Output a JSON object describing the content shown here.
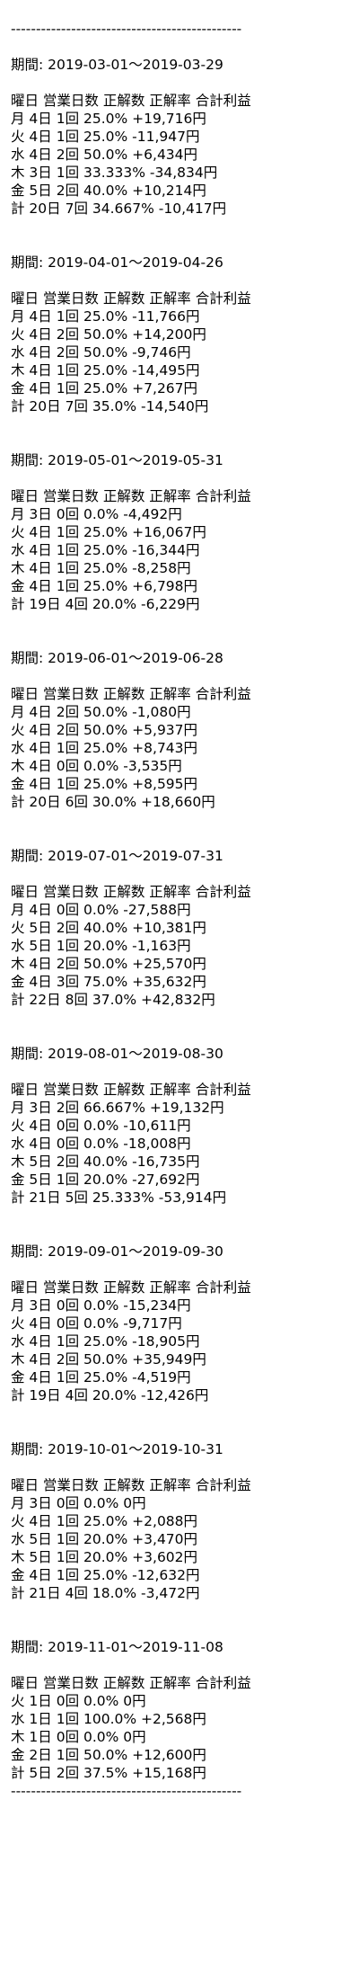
{
  "top_rule": "----------------------------------------------",
  "bottom_rule": "----------------------------------------------",
  "header": "曜日 営業日数 正解数 正解率 合計利益",
  "sections": [
    {
      "period": "期間: 2019-03-01〜2019-03-29",
      "rows": [
        "月 4日 1回 25.0% +19,716円",
        "火 4日 1回 25.0% -11,947円",
        "水 4日 2回 50.0% +6,434円",
        "木 3日 1回 33.333% -34,834円",
        "金 5日 2回 40.0% +10,214円",
        "計 20日 7回 34.667% -10,417円"
      ]
    },
    {
      "period": "期間: 2019-04-01〜2019-04-26",
      "rows": [
        "月 4日 1回 25.0% -11,766円",
        "火 4日 2回 50.0% +14,200円",
        "水 4日 2回 50.0% -9,746円",
        "木 4日 1回 25.0% -14,495円",
        "金 4日 1回 25.0% +7,267円",
        "計 20日 7回 35.0% -14,540円"
      ]
    },
    {
      "period": "期間: 2019-05-01〜2019-05-31",
      "rows": [
        "月 3日 0回 0.0% -4,492円",
        "火 4日 1回 25.0% +16,067円",
        "水 4日 1回 25.0% -16,344円",
        "木 4日 1回 25.0% -8,258円",
        "金 4日 1回 25.0% +6,798円",
        "計 19日 4回 20.0% -6,229円"
      ]
    },
    {
      "period": "期間: 2019-06-01〜2019-06-28",
      "rows": [
        "月 4日 2回 50.0% -1,080円",
        "火 4日 2回 50.0% +5,937円",
        "水 4日 1回 25.0% +8,743円",
        "木 4日 0回 0.0% -3,535円",
        "金 4日 1回 25.0% +8,595円",
        "計 20日 6回 30.0% +18,660円"
      ]
    },
    {
      "period": "期間: 2019-07-01〜2019-07-31",
      "rows": [
        "月 4日 0回 0.0% -27,588円",
        "火 5日 2回 40.0% +10,381円",
        "水 5日 1回 20.0% -1,163円",
        "木 4日 2回 50.0% +25,570円",
        "金 4日 3回 75.0% +35,632円",
        "計 22日 8回 37.0% +42,832円"
      ]
    },
    {
      "period": "期間: 2019-08-01〜2019-08-30",
      "rows": [
        "月 3日 2回 66.667% +19,132円",
        "火 4日 0回 0.0% -10,611円",
        "水 4日 0回 0.0% -18,008円",
        "木 5日 2回 40.0% -16,735円",
        "金 5日 1回 20.0% -27,692円",
        "計 21日 5回 25.333% -53,914円"
      ]
    },
    {
      "period": "期間: 2019-09-01〜2019-09-30",
      "rows": [
        "月 3日 0回 0.0% -15,234円",
        "火 4日 0回 0.0% -9,717円",
        "水 4日 1回 25.0% -18,905円",
        "木 4日 2回 50.0% +35,949円",
        "金 4日 1回 25.0% -4,519円",
        "計 19日 4回 20.0% -12,426円"
      ]
    },
    {
      "period": "期間: 2019-10-01〜2019-10-31",
      "rows": [
        "月 3日 0回 0.0% 0円",
        "火 4日 1回 25.0% +2,088円",
        "水 5日 1回 20.0% +3,470円",
        "木 5日 1回 20.0% +3,602円",
        "金 4日 1回 25.0% -12,632円",
        "計 21日 4回 18.0% -3,472円"
      ]
    },
    {
      "period": "期間: 2019-11-01〜2019-11-08",
      "rows": [
        "火 1日 0回 0.0% 0円",
        "水 1日 1回 100.0% +2,568円",
        "木 1日 0回 0.0% 0円",
        "金 2日 1回 50.0% +12,600円",
        "計 5日 2回 37.5% +15,168円"
      ]
    }
  ]
}
